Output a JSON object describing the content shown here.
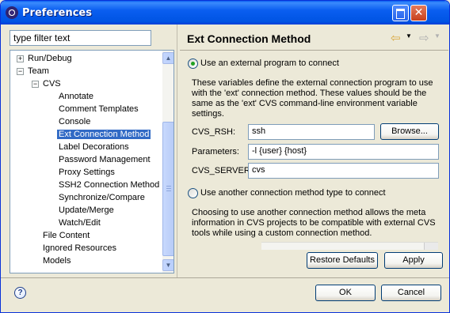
{
  "window": {
    "title": "Preferences"
  },
  "titlebar": {
    "close_glyph": "✕"
  },
  "sidebar": {
    "filter_placeholder": "type filter text",
    "tree": [
      {
        "label": "Run/Debug",
        "expander": "+"
      },
      {
        "label": "Team",
        "expander": "−"
      },
      {
        "label": "CVS",
        "expander": "−"
      },
      {
        "label": "Annotate"
      },
      {
        "label": "Comment Templates"
      },
      {
        "label": "Console"
      },
      {
        "label": "Ext Connection Method",
        "selected": true
      },
      {
        "label": "Label Decorations"
      },
      {
        "label": "Password Management"
      },
      {
        "label": "Proxy Settings"
      },
      {
        "label": "SSH2 Connection Method"
      },
      {
        "label": "Synchronize/Compare"
      },
      {
        "label": "Update/Merge"
      },
      {
        "label": "Watch/Edit"
      },
      {
        "label": "File Content"
      },
      {
        "label": "Ignored Resources"
      },
      {
        "label": "Models"
      }
    ],
    "scroll_up": "▲",
    "scroll_down": "▼"
  },
  "page": {
    "title": "Ext Connection Method",
    "nav_back": "⇦",
    "nav_forward": "⇨",
    "nav_dropdown": "▼",
    "radio_external": {
      "label": "Use an external program to connect",
      "checked": true
    },
    "external_description": "These variables define the external connection program to use with the 'ext' connection method. These values should be the same as the 'ext' CVS command-line environment variable settings.",
    "fields": {
      "cvs_rsh": {
        "label": "CVS_RSH:",
        "value": "ssh"
      },
      "parameters": {
        "label": "Parameters:",
        "value": "-l {user} {host}"
      },
      "cvs_server": {
        "label": "CVS_SERVER:",
        "value": "cvs"
      }
    },
    "browse_label": "Browse...",
    "radio_other": {
      "label": "Use another connection method type to connect",
      "checked": false
    },
    "other_description": "Choosing to use another connection method allows the meta information in CVS projects to be compatible with external CVS tools while using a custom connection method."
  },
  "buttons": {
    "restore_defaults": "Restore Defaults",
    "apply": "Apply",
    "ok": "OK",
    "cancel": "Cancel",
    "help": "?"
  },
  "colors": {
    "titlebar": "#0054e3",
    "selection": "#316ac5",
    "dialog_bg": "#ece9d8"
  }
}
